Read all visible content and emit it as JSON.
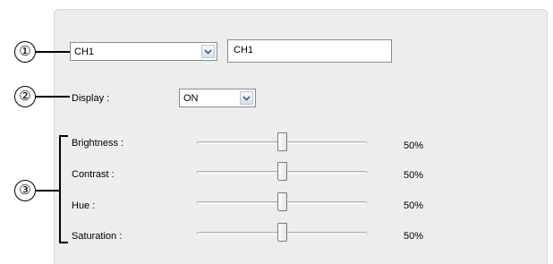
{
  "callouts": [
    "①",
    "②",
    "③"
  ],
  "channel": {
    "selected": "CH1",
    "name_value": "CH1"
  },
  "display": {
    "label": "Display :",
    "selected": "ON"
  },
  "adjustments": [
    {
      "label": "Brightness :",
      "value_text": "50%",
      "value": 0.5
    },
    {
      "label": "Contrast :",
      "value_text": "50%",
      "value": 0.5
    },
    {
      "label": "Hue :",
      "value_text": "50%",
      "value": 0.5
    },
    {
      "label": "Saturation :",
      "value_text": "50%",
      "value": 0.5
    }
  ],
  "icons": {
    "dropdown": "chevron-down-icon"
  }
}
